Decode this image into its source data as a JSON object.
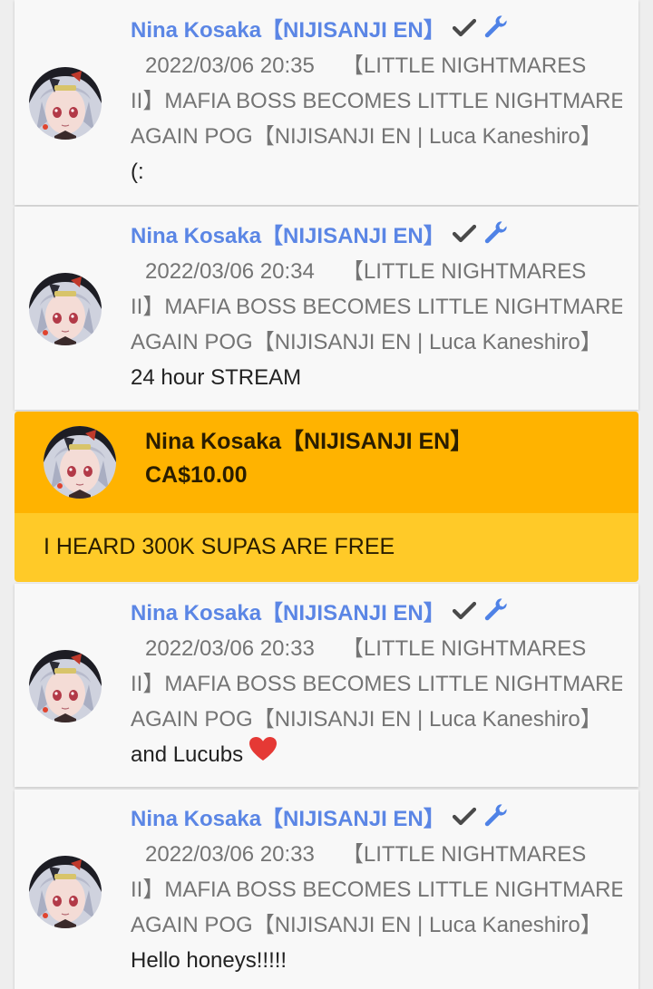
{
  "messages": [
    {
      "author": "Nina Kosaka【NIJISANJI EN】",
      "timestamp": "2022/03/06 20:35",
      "title_line1": "【LITTLE NIGHTMARES",
      "title_line2": "II】MAFIA BOSS BECOMES LITTLE NIGHTMARE",
      "title_line3": "AGAIN POG【NIJISANJI EN | Luca Kaneshiro】",
      "text": "(:"
    },
    {
      "author": "Nina Kosaka【NIJISANJI EN】",
      "timestamp": "2022/03/06 20:34",
      "title_line1": "【LITTLE NIGHTMARES",
      "title_line2": "II】MAFIA BOSS BECOMES LITTLE NIGHTMARE",
      "title_line3": "AGAIN POG【NIJISANJI EN | Luca Kaneshiro】",
      "text": "24 hour STREAM"
    },
    {
      "author": "Nina Kosaka【NIJISANJI EN】",
      "timestamp": "2022/03/06 20:33",
      "title_line1": "【LITTLE NIGHTMARES",
      "title_line2": "II】MAFIA BOSS BECOMES LITTLE NIGHTMARE",
      "title_line3": "AGAIN POG【NIJISANJI EN | Luca Kaneshiro】",
      "text": "and Lucubs",
      "emoji": "heart-emoji"
    },
    {
      "author": "Nina Kosaka【NIJISANJI EN】",
      "timestamp": "2022/03/06 20:33",
      "title_line1": "【LITTLE NIGHTMARES",
      "title_line2": "II】MAFIA BOSS BECOMES LITTLE NIGHTMARE",
      "title_line3": "AGAIN POG【NIJISANJI EN | Luca Kaneshiro】",
      "text": "Hello honeys!!!!!"
    }
  ],
  "superchat": {
    "author": "Nina Kosaka【NIJISANJI EN】",
    "amount": "CA$10.00",
    "message": "I HEARD 300K SUPAS ARE FREE",
    "header_color": "#ffb300",
    "body_color": "#ffca28"
  },
  "icons": {
    "verified": "check-icon",
    "moderator": "wrench-icon"
  },
  "colors": {
    "author_link": "#5b86e5",
    "meta_text": "#747474",
    "card_bg": "#f8f8f8",
    "page_bg": "#eeeeee"
  }
}
